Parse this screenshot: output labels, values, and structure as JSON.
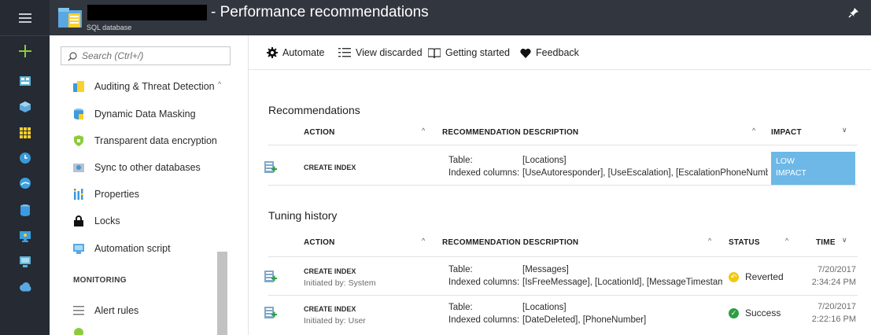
{
  "header": {
    "title": "- Performance recommendations",
    "resource_type": "SQL database"
  },
  "leftnav": {
    "icons": [
      "hamburger-icon",
      "plus-icon",
      "dashboard-icon",
      "cube-icon",
      "grid-icon",
      "clock-icon",
      "globe-icon",
      "sql-db-icon",
      "monitor-icon",
      "vm-icon",
      "cloud-icon"
    ]
  },
  "blade": {
    "search_placeholder": "Search (Ctrl+/)",
    "items": [
      {
        "label": "Auditing & Threat Detection",
        "icon": "audit-icon"
      },
      {
        "label": "Dynamic Data Masking",
        "icon": "masking-icon"
      },
      {
        "label": "Transparent data encryption",
        "icon": "shield-icon"
      },
      {
        "label": "Sync to other databases",
        "icon": "sync-icon"
      },
      {
        "label": "Properties",
        "icon": "properties-icon"
      },
      {
        "label": "Locks",
        "icon": "lock-icon"
      },
      {
        "label": "Automation script",
        "icon": "script-icon"
      }
    ],
    "monitoring_heading": "MONITORING",
    "monitoring_items": [
      {
        "label": "Alert rules",
        "icon": "alert-rules-icon"
      }
    ]
  },
  "toolbar": {
    "automate": "Automate",
    "view_discarded": "View discarded",
    "getting_started": "Getting started",
    "feedback": "Feedback"
  },
  "recommendations": {
    "heading": "Recommendations",
    "columns": {
      "action": "ACTION",
      "description": "RECOMMENDATION DESCRIPTION",
      "impact": "IMPACT"
    },
    "rows": [
      {
        "action": "CREATE INDEX",
        "table_label": "Table:",
        "table_value": "[Locations]",
        "indexed_label": "Indexed columns:",
        "indexed_value": "[UseAutoresponder], [UseEscalation], [EscalationPhoneNumbe",
        "impact_line1": "LOW",
        "impact_line2": "IMPACT"
      }
    ]
  },
  "tuning": {
    "heading": "Tuning history",
    "columns": {
      "action": "ACTION",
      "description": "RECOMMENDATION DESCRIPTION",
      "status": "STATUS",
      "time": "TIME"
    },
    "rows": [
      {
        "action": "CREATE INDEX",
        "initiated": "Initiated by: System",
        "table_label": "Table:",
        "table_value": "[Messages]",
        "indexed_label": "Indexed columns:",
        "indexed_value": "[IsFreeMessage], [LocationId], [MessageTimestam",
        "status": "Reverted",
        "status_color": "#f2c811",
        "date": "7/20/2017",
        "time": "2:34:24 PM"
      },
      {
        "action": "CREATE INDEX",
        "initiated": "Initiated by: User",
        "table_label": "Table:",
        "table_value": "[Locations]",
        "indexed_label": "Indexed columns:",
        "indexed_value": "[DateDeleted], [PhoneNumber]",
        "status": "Success",
        "status_color": "#2e9e44",
        "date": "7/20/2017",
        "time": "2:22:16 PM"
      }
    ]
  },
  "colors": {
    "nav_bg": "#252a33",
    "title_bg": "#32363f",
    "impact_bg": "#6db8e6",
    "accent": "#0072c6"
  }
}
